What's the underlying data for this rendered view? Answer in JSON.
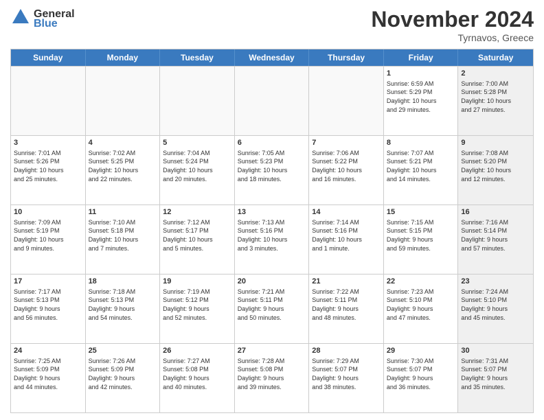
{
  "header": {
    "logo_line1": "General",
    "logo_line2": "Blue",
    "month": "November 2024",
    "location": "Tyrnavos, Greece"
  },
  "weekdays": [
    "Sunday",
    "Monday",
    "Tuesday",
    "Wednesday",
    "Thursday",
    "Friday",
    "Saturday"
  ],
  "rows": [
    [
      {
        "day": "",
        "text": "",
        "empty": true
      },
      {
        "day": "",
        "text": "",
        "empty": true
      },
      {
        "day": "",
        "text": "",
        "empty": true
      },
      {
        "day": "",
        "text": "",
        "empty": true
      },
      {
        "day": "",
        "text": "",
        "empty": true
      },
      {
        "day": "1",
        "text": "Sunrise: 6:59 AM\nSunset: 5:29 PM\nDaylight: 10 hours\nand 29 minutes.",
        "empty": false
      },
      {
        "day": "2",
        "text": "Sunrise: 7:00 AM\nSunset: 5:28 PM\nDaylight: 10 hours\nand 27 minutes.",
        "empty": false,
        "shaded": true
      }
    ],
    [
      {
        "day": "3",
        "text": "Sunrise: 7:01 AM\nSunset: 5:26 PM\nDaylight: 10 hours\nand 25 minutes.",
        "empty": false
      },
      {
        "day": "4",
        "text": "Sunrise: 7:02 AM\nSunset: 5:25 PM\nDaylight: 10 hours\nand 22 minutes.",
        "empty": false
      },
      {
        "day": "5",
        "text": "Sunrise: 7:04 AM\nSunset: 5:24 PM\nDaylight: 10 hours\nand 20 minutes.",
        "empty": false
      },
      {
        "day": "6",
        "text": "Sunrise: 7:05 AM\nSunset: 5:23 PM\nDaylight: 10 hours\nand 18 minutes.",
        "empty": false
      },
      {
        "day": "7",
        "text": "Sunrise: 7:06 AM\nSunset: 5:22 PM\nDaylight: 10 hours\nand 16 minutes.",
        "empty": false
      },
      {
        "day": "8",
        "text": "Sunrise: 7:07 AM\nSunset: 5:21 PM\nDaylight: 10 hours\nand 14 minutes.",
        "empty": false
      },
      {
        "day": "9",
        "text": "Sunrise: 7:08 AM\nSunset: 5:20 PM\nDaylight: 10 hours\nand 12 minutes.",
        "empty": false,
        "shaded": true
      }
    ],
    [
      {
        "day": "10",
        "text": "Sunrise: 7:09 AM\nSunset: 5:19 PM\nDaylight: 10 hours\nand 9 minutes.",
        "empty": false
      },
      {
        "day": "11",
        "text": "Sunrise: 7:10 AM\nSunset: 5:18 PM\nDaylight: 10 hours\nand 7 minutes.",
        "empty": false
      },
      {
        "day": "12",
        "text": "Sunrise: 7:12 AM\nSunset: 5:17 PM\nDaylight: 10 hours\nand 5 minutes.",
        "empty": false
      },
      {
        "day": "13",
        "text": "Sunrise: 7:13 AM\nSunset: 5:16 PM\nDaylight: 10 hours\nand 3 minutes.",
        "empty": false
      },
      {
        "day": "14",
        "text": "Sunrise: 7:14 AM\nSunset: 5:16 PM\nDaylight: 10 hours\nand 1 minute.",
        "empty": false
      },
      {
        "day": "15",
        "text": "Sunrise: 7:15 AM\nSunset: 5:15 PM\nDaylight: 9 hours\nand 59 minutes.",
        "empty": false
      },
      {
        "day": "16",
        "text": "Sunrise: 7:16 AM\nSunset: 5:14 PM\nDaylight: 9 hours\nand 57 minutes.",
        "empty": false,
        "shaded": true
      }
    ],
    [
      {
        "day": "17",
        "text": "Sunrise: 7:17 AM\nSunset: 5:13 PM\nDaylight: 9 hours\nand 56 minutes.",
        "empty": false
      },
      {
        "day": "18",
        "text": "Sunrise: 7:18 AM\nSunset: 5:13 PM\nDaylight: 9 hours\nand 54 minutes.",
        "empty": false
      },
      {
        "day": "19",
        "text": "Sunrise: 7:19 AM\nSunset: 5:12 PM\nDaylight: 9 hours\nand 52 minutes.",
        "empty": false
      },
      {
        "day": "20",
        "text": "Sunrise: 7:21 AM\nSunset: 5:11 PM\nDaylight: 9 hours\nand 50 minutes.",
        "empty": false
      },
      {
        "day": "21",
        "text": "Sunrise: 7:22 AM\nSunset: 5:11 PM\nDaylight: 9 hours\nand 48 minutes.",
        "empty": false
      },
      {
        "day": "22",
        "text": "Sunrise: 7:23 AM\nSunset: 5:10 PM\nDaylight: 9 hours\nand 47 minutes.",
        "empty": false
      },
      {
        "day": "23",
        "text": "Sunrise: 7:24 AM\nSunset: 5:10 PM\nDaylight: 9 hours\nand 45 minutes.",
        "empty": false,
        "shaded": true
      }
    ],
    [
      {
        "day": "24",
        "text": "Sunrise: 7:25 AM\nSunset: 5:09 PM\nDaylight: 9 hours\nand 44 minutes.",
        "empty": false
      },
      {
        "day": "25",
        "text": "Sunrise: 7:26 AM\nSunset: 5:09 PM\nDaylight: 9 hours\nand 42 minutes.",
        "empty": false
      },
      {
        "day": "26",
        "text": "Sunrise: 7:27 AM\nSunset: 5:08 PM\nDaylight: 9 hours\nand 40 minutes.",
        "empty": false
      },
      {
        "day": "27",
        "text": "Sunrise: 7:28 AM\nSunset: 5:08 PM\nDaylight: 9 hours\nand 39 minutes.",
        "empty": false
      },
      {
        "day": "28",
        "text": "Sunrise: 7:29 AM\nSunset: 5:07 PM\nDaylight: 9 hours\nand 38 minutes.",
        "empty": false
      },
      {
        "day": "29",
        "text": "Sunrise: 7:30 AM\nSunset: 5:07 PM\nDaylight: 9 hours\nand 36 minutes.",
        "empty": false
      },
      {
        "day": "30",
        "text": "Sunrise: 7:31 AM\nSunset: 5:07 PM\nDaylight: 9 hours\nand 35 minutes.",
        "empty": false,
        "shaded": true
      }
    ]
  ]
}
